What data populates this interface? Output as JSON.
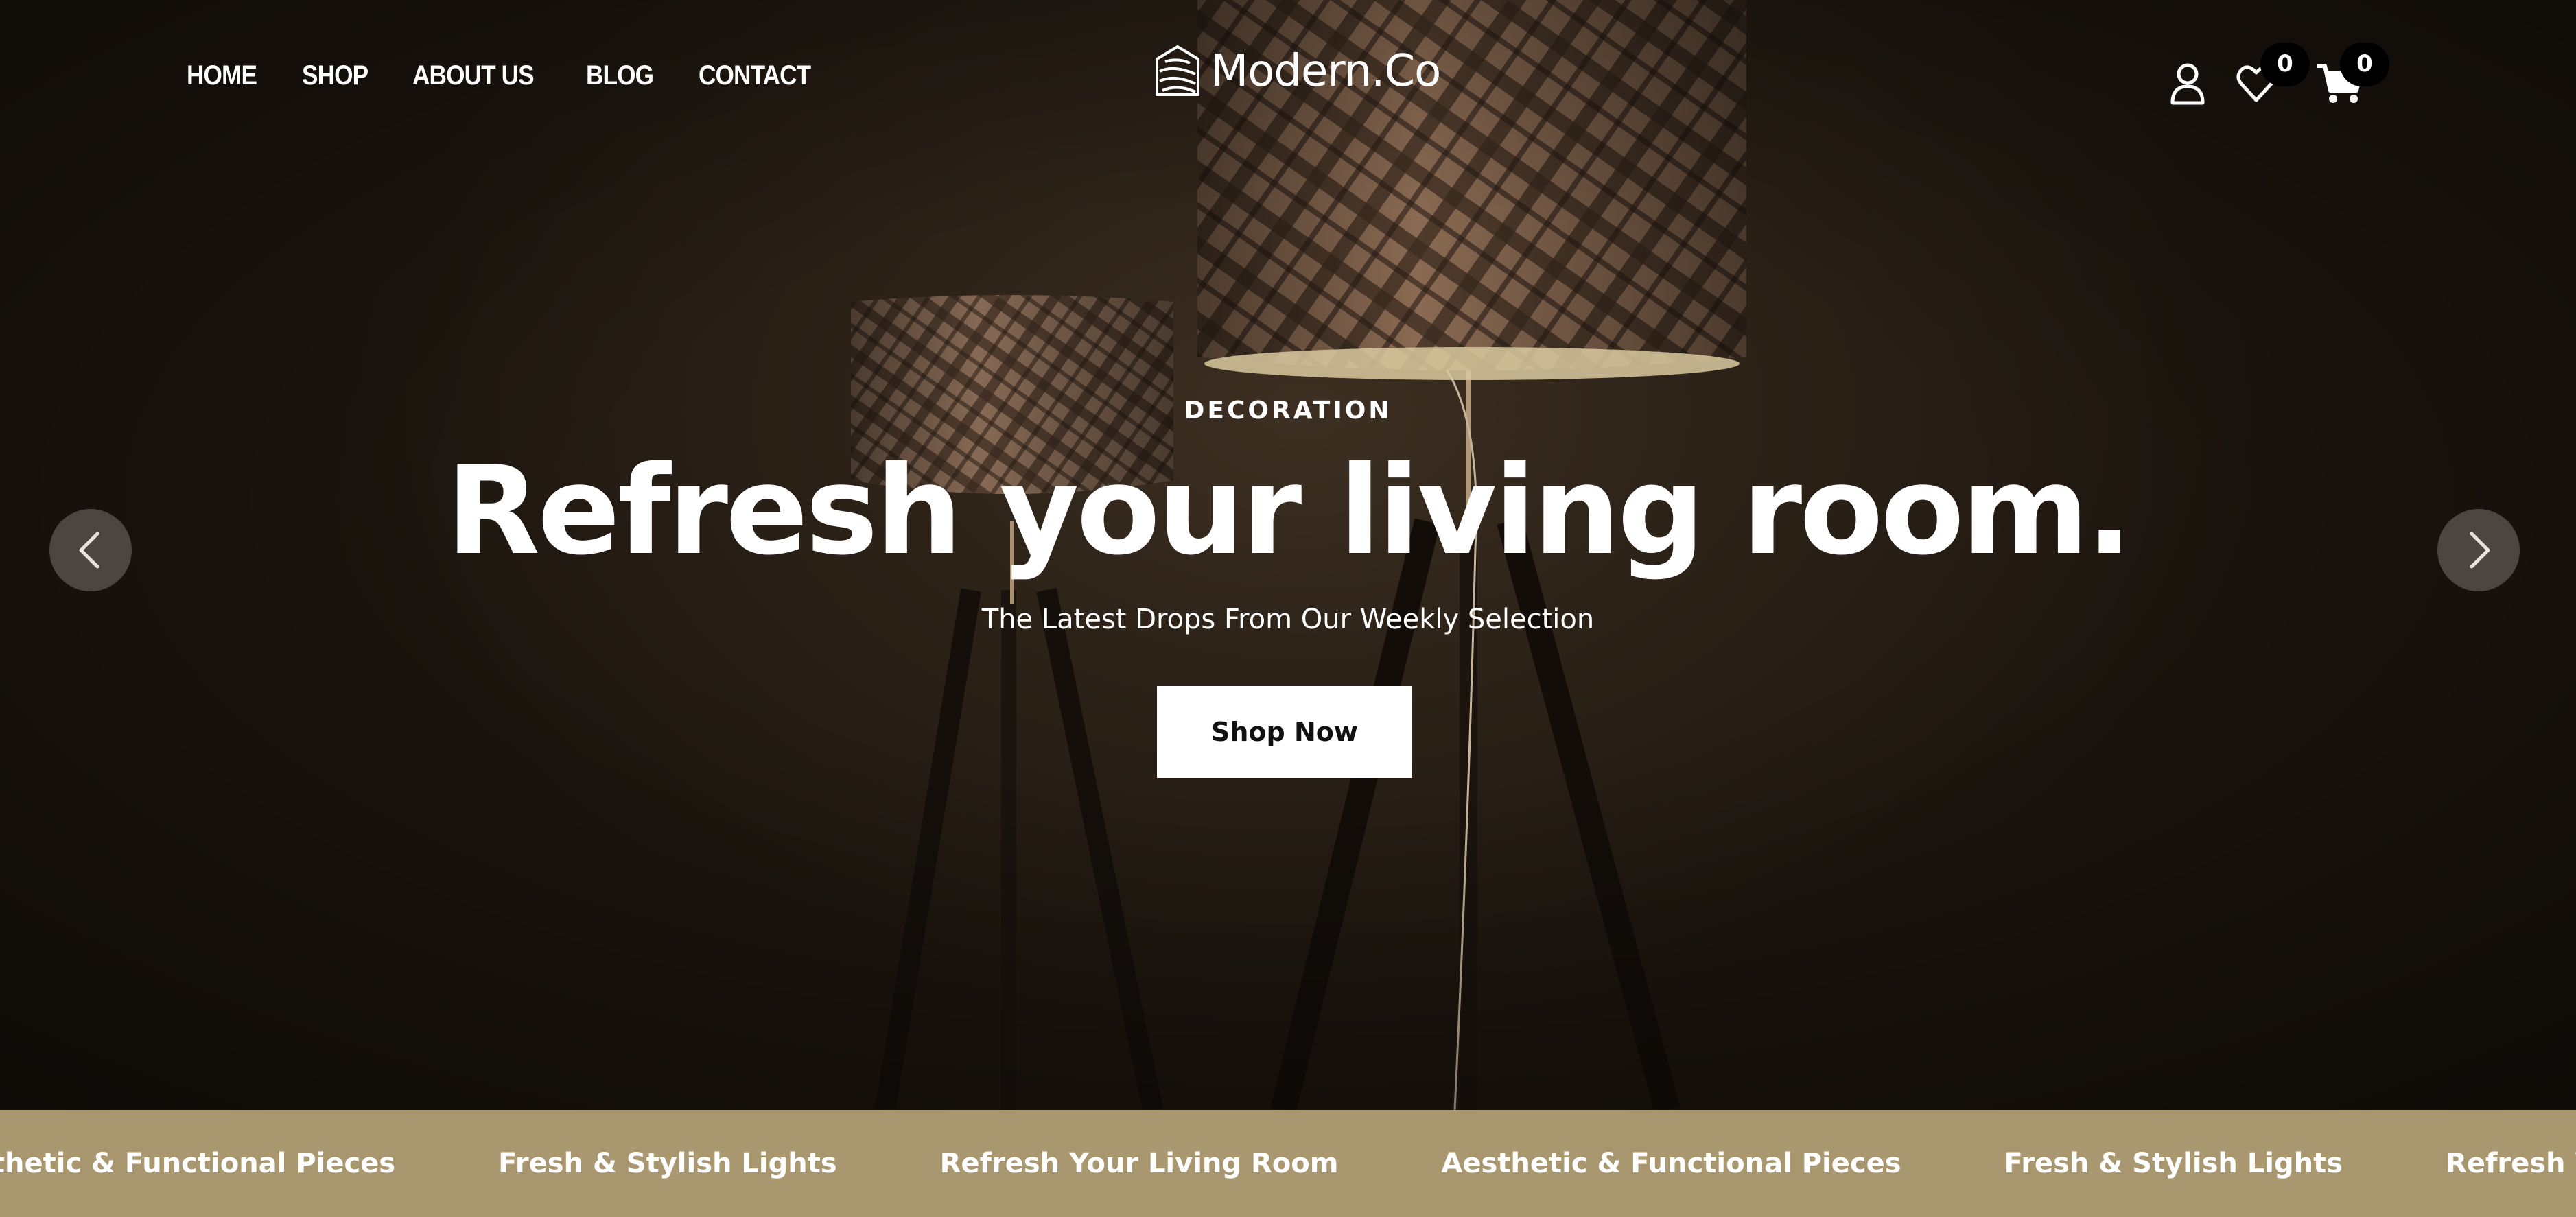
{
  "header": {
    "nav": [
      {
        "label": "HOME"
      },
      {
        "label": "SHOP"
      },
      {
        "label": "ABOUT US"
      },
      {
        "label": "BLOG"
      },
      {
        "label": "CONTACT"
      }
    ],
    "logo_text": "Modern.Co",
    "wishlist_count": "0",
    "cart_count": "0",
    "icons": [
      "user-icon",
      "heart-icon",
      "cart-icon"
    ]
  },
  "hero": {
    "eyebrow": "DECORATION",
    "headline": "Refresh your living room.",
    "subtitle": "The Latest Drops From Our Weekly Selection",
    "button_label": "Shop Now",
    "prev_icon": "chevron-left-icon",
    "next_icon": "chevron-right-icon"
  },
  "marquee": {
    "items": [
      "Aesthetic & Functional Pieces",
      "Fresh & Stylish Lights",
      "Refresh Your Living Room",
      "Aesthetic & Functional Pieces",
      "Fresh & Stylish Lights",
      "Refresh Your Living Room"
    ]
  },
  "colors": {
    "marquee_bg": "#a99770",
    "badge_bg": "#000000",
    "button_bg": "#ffffff",
    "hero_bg": "#2c2218"
  }
}
